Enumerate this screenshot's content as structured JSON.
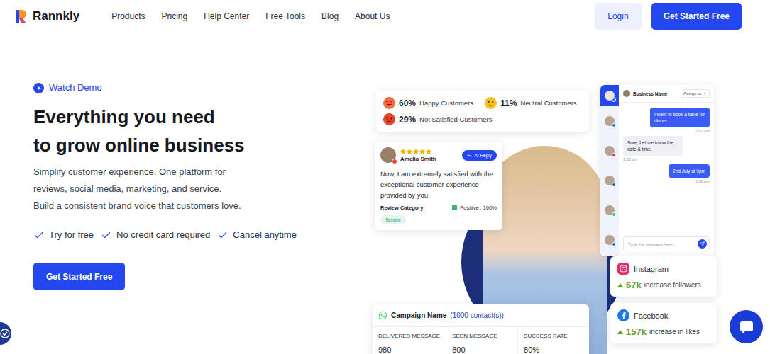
{
  "logo": {
    "text": "Rannkly"
  },
  "nav": {
    "items": [
      "Products",
      "Pricing",
      "Help Center",
      "Free Tools",
      "Blog",
      "About Us"
    ],
    "login": "Login",
    "cta": "Get Started Free"
  },
  "hero": {
    "demo": "Watch Demo",
    "title_lines": [
      "Everything you need",
      "to grow online business"
    ],
    "description_lines": [
      "Simplify customer experience. One platform for",
      "reviews, social media, marketing, and service.",
      "Build a consistent brand voice that customers love."
    ],
    "checks": [
      "Try for free",
      "No credit card required",
      "Cancel anytime"
    ],
    "cta": "Get Started Free"
  },
  "sentiment": [
    {
      "kind": "happy",
      "percent": "60%",
      "label": "Happy Customers",
      "color": "#f26b3a"
    },
    {
      "kind": "neutral",
      "percent": "11%",
      "label": "Neutral Customers",
      "color": "#f7c21b"
    },
    {
      "kind": "angry",
      "percent": "29%",
      "label": "Not Satisfied Customers",
      "color": "#e8452c"
    }
  ],
  "review": {
    "name": "Amelia Smith",
    "stars": 5,
    "ai_reply": "AI Reply",
    "text": "Now, I am extremely satisfied with the exceptional customer experience provided by you.",
    "category_label": "Review Category",
    "sentiment": "Positive : 100%",
    "tag": "Service"
  },
  "chat": {
    "business": "Business Name",
    "assign": "Assign to",
    "contacts": [
      {
        "selected": true,
        "color": "#1877f2"
      },
      {
        "selected": false,
        "color": "#1877f2"
      },
      {
        "selected": false,
        "color": "#e1306c"
      },
      {
        "selected": false,
        "color": "#0a66c2"
      },
      {
        "selected": false,
        "color": "#25d366"
      },
      {
        "selected": false,
        "color": "#1877f2"
      }
    ],
    "messages": [
      {
        "text": "I want to book a table for dinner.",
        "time": "1:02 pm",
        "sent": true
      },
      {
        "text": "Sure, Let me know the date & time.",
        "time": "1:02 pm",
        "sent": false
      },
      {
        "text": "2nd July at 9pm",
        "time": "1:02 pm",
        "sent": true
      }
    ],
    "placeholder": "Type the message here..."
  },
  "social": [
    {
      "network": "Instagram",
      "value": "67k",
      "label": "increase followers",
      "color": "#e1306c"
    },
    {
      "network": "Facebook",
      "value": "157k",
      "label": "increase in likes",
      "color": "#1877f2"
    }
  ],
  "campaign": {
    "title": "Campaign Name",
    "contacts": "(1000 contact(s))",
    "stats": [
      {
        "label": "DELIVERED MESSAGE",
        "value": "980"
      },
      {
        "label": "SEEN MESSAGE",
        "value": "800"
      },
      {
        "label": "SUCCESS RATE",
        "value": "80%"
      }
    ]
  }
}
